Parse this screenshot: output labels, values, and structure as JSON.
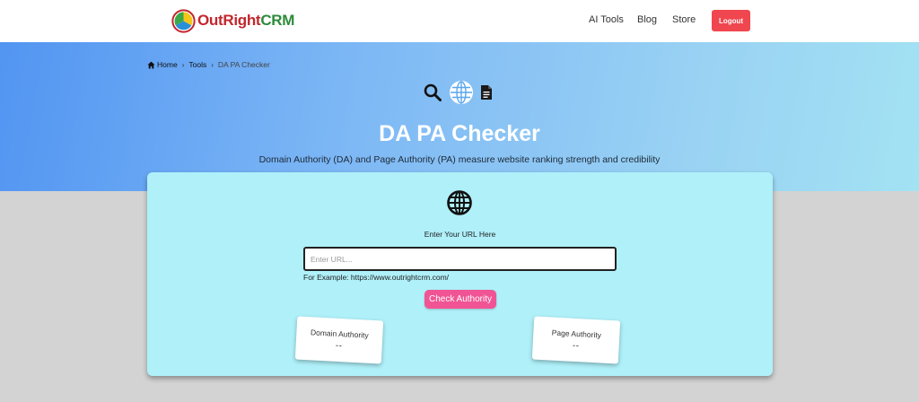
{
  "header": {
    "logo": {
      "brand_primary": "OutRight",
      "brand_secondary": "CRM"
    },
    "nav": [
      {
        "label": "AI Tools"
      },
      {
        "label": "Blog"
      },
      {
        "label": "Store"
      }
    ],
    "logout_label": "Logout",
    "logout_color": "#f0464f"
  },
  "breadcrumb": {
    "home": "Home",
    "tools": "Tools",
    "current": "DA PA Checker",
    "separator": "›"
  },
  "hero": {
    "icons": [
      "search-icon",
      "globe-icon",
      "document-icon"
    ],
    "title": "DA PA Checker",
    "subtitle": "Domain Authority (DA) and Page Authority (PA) measure website ranking strength and credibility"
  },
  "tool": {
    "icon": "globe-icon",
    "url_label": "Enter Your URL Here",
    "url_value": "",
    "url_placeholder": "Enter URL...",
    "example": "For Example: https://www.outrightcrm.com/",
    "check_button": "Check Authority",
    "check_button_color": "#f05494",
    "metrics": {
      "domain_authority": {
        "label": "Domain Authority",
        "value": "--"
      },
      "page_authority": {
        "label": "Page Authority",
        "value": "--"
      }
    }
  }
}
